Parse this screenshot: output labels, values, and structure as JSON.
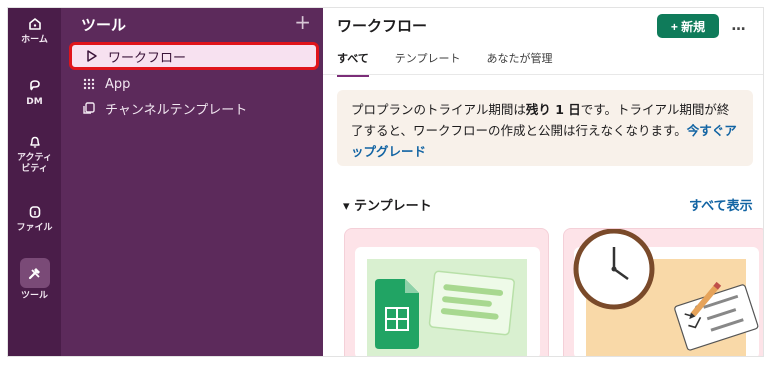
{
  "rail": {
    "items": [
      {
        "label": "ホーム",
        "icon": "home-icon"
      },
      {
        "label": "DM",
        "icon": "dm-icon"
      },
      {
        "label": "アクティ\nビティ",
        "icon": "bell-icon"
      },
      {
        "label": "ファイル",
        "icon": "file-icon"
      },
      {
        "label": "ツール",
        "icon": "tools-icon"
      }
    ]
  },
  "sidebar": {
    "title": "ツール",
    "add": "+",
    "items": [
      {
        "label": "ワークフロー",
        "icon": "play-icon"
      },
      {
        "label": "App",
        "icon": "grid-icon"
      },
      {
        "label": "チャンネルテンプレート",
        "icon": "copy-icon"
      }
    ]
  },
  "main": {
    "title": "ワークフロー",
    "new_button": "+ 新規",
    "more": "…",
    "tabs": [
      "すべて",
      "テンプレート",
      "あなたが管理"
    ],
    "banner": {
      "part1": "プロプランのトライアル期間は",
      "bold": "残り 1 日",
      "part2": "です。トライアル期間が終了すると、ワークフローの作成と公開は行えなくなります。",
      "link": "今すぐアップグレード"
    },
    "templates_heading": "▾ テンプレート",
    "show_all": "すべて表示"
  },
  "colors": {
    "rail": "#4a1d49",
    "sidebar": "#5c2a5b",
    "accent_green": "#0f7b5a",
    "link": "#1264a3",
    "highlight": "#e0141b"
  }
}
